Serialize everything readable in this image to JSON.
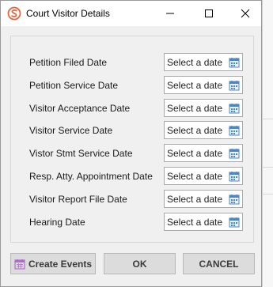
{
  "window": {
    "title": "Court Visitor Details",
    "app_icon": "app-logo-icon",
    "controls": [
      "minimize-icon",
      "maximize-icon",
      "close-icon"
    ]
  },
  "form": {
    "fields": [
      {
        "label": "Petition Filed Date",
        "placeholder": "Select a date"
      },
      {
        "label": "Petition Service Date",
        "placeholder": "Select a date"
      },
      {
        "label": "Visitor Acceptance Date",
        "placeholder": "Select a date"
      },
      {
        "label": "Visitor Service Date",
        "placeholder": "Select a date"
      },
      {
        "label": "Vistor Stmt Service Date",
        "placeholder": "Select a date"
      },
      {
        "label": "Resp. Atty. Appointment Date",
        "placeholder": "Select a date"
      },
      {
        "label": "Visitor Report File Date",
        "placeholder": "Select a date"
      },
      {
        "label": "Hearing Date",
        "placeholder": "Select a date"
      }
    ]
  },
  "footer": {
    "create_events_label": "Create Events",
    "ok_label": "OK",
    "cancel_label": "CANCEL"
  },
  "colors": {
    "accent": "#e8643c",
    "calendar_icon": "#4a86c8",
    "create_icon": "#b26bd0"
  }
}
